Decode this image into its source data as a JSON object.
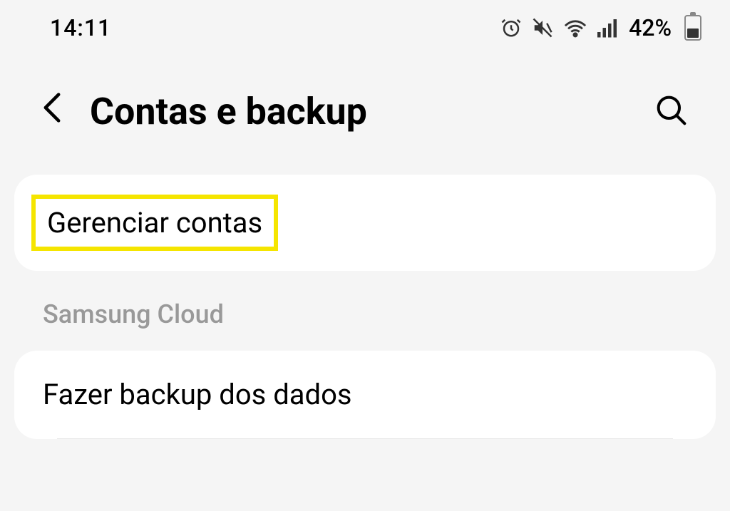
{
  "status": {
    "time": "14:11",
    "battery_percent": "42%"
  },
  "header": {
    "title": "Contas e backup"
  },
  "items": {
    "manage_accounts": "Gerenciar contas"
  },
  "sections": {
    "samsung_cloud": {
      "label": "Samsung Cloud",
      "backup_data": "Fazer backup dos dados"
    }
  }
}
